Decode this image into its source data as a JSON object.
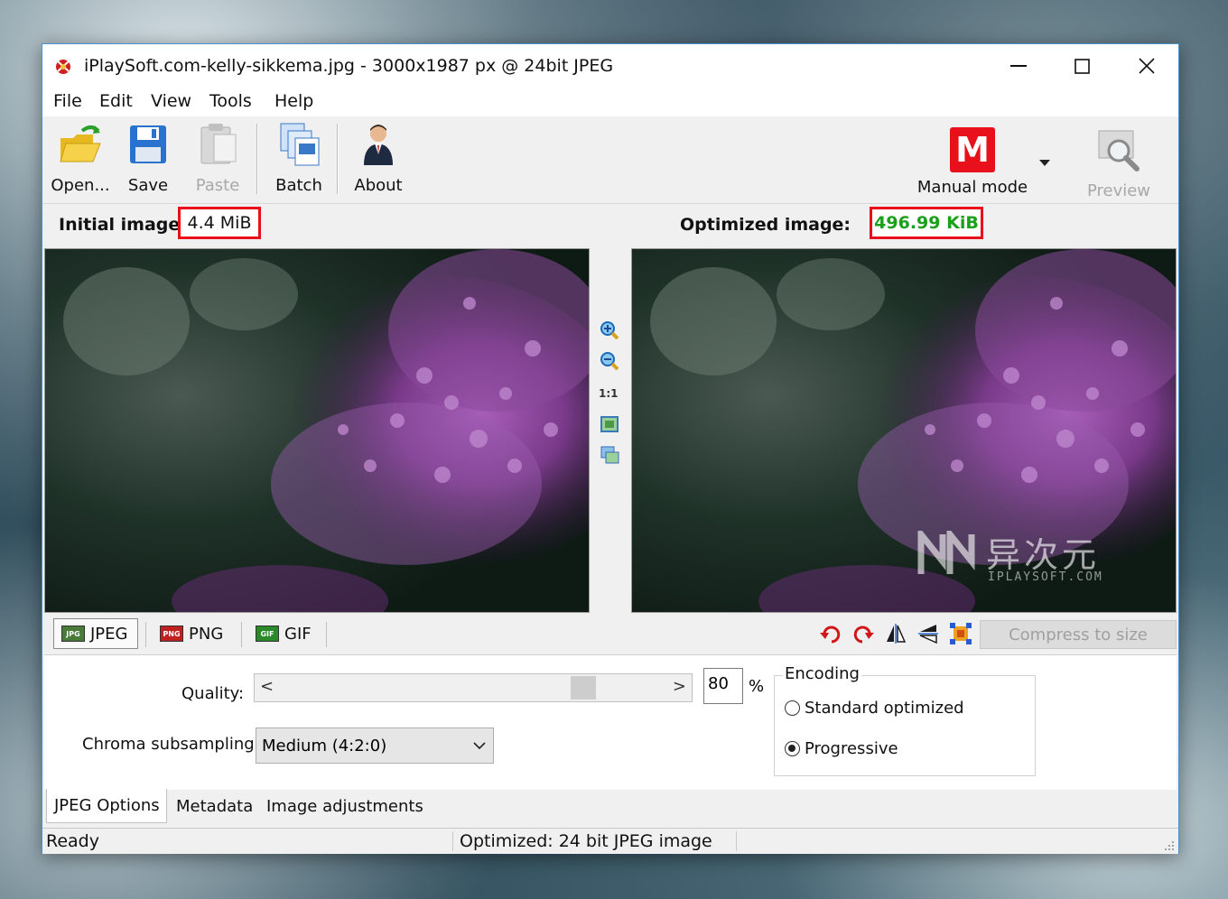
{
  "window": {
    "title": "iPlaySoft.com-kelly-sikkema.jpg - 3000x1987 px @ 24bit JPEG",
    "minimize": "—",
    "maximize": "☐",
    "close": "✕"
  },
  "menu": [
    "File",
    "Edit",
    "View",
    "Tools",
    "Help"
  ],
  "toolbar": {
    "open_label": "Open...",
    "save_label": "Save",
    "paste_label": "Paste",
    "batch_label": "Batch",
    "about_label": "About",
    "mode_label": "Manual mode",
    "mode_letter": "M",
    "preview_label": "Preview"
  },
  "sizes": {
    "initial_label": "Initial image:",
    "initial_value": "4.4 MiB",
    "optimized_label": "Optimized image:",
    "optimized_value": "496.99 KiB"
  },
  "zoom": {
    "ratio_label": "1:1"
  },
  "formats": {
    "jpeg_label": "JPEG",
    "png_label": "PNG",
    "gif_label": "GIF",
    "compress_label": "Compress to size"
  },
  "options": {
    "quality_label": "Quality:",
    "quality_value": "80",
    "percent": "%",
    "chroma_label": "Chroma subsampling:",
    "chroma_value": "Medium (4:2:0)",
    "encoding_title": "Encoding",
    "standard_label": "Standard optimized",
    "progressive_label": "Progressive",
    "selected_encoding": "Progressive",
    "slider_left": "<",
    "slider_right": ">"
  },
  "bottom_tabs": [
    "JPEG Options",
    "Metadata",
    "Image adjustments"
  ],
  "status": {
    "left": "Ready",
    "right": "Optimized: 24 bit JPEG image"
  },
  "watermark": {
    "brand": "异次元",
    "site": "IPLAYSOFT.COM"
  },
  "colors": {
    "accent_border": "#4a90d0",
    "highlight_red": "#e8101a",
    "optimized_green": "#1aa01a",
    "mode_red": "#e8101a"
  }
}
